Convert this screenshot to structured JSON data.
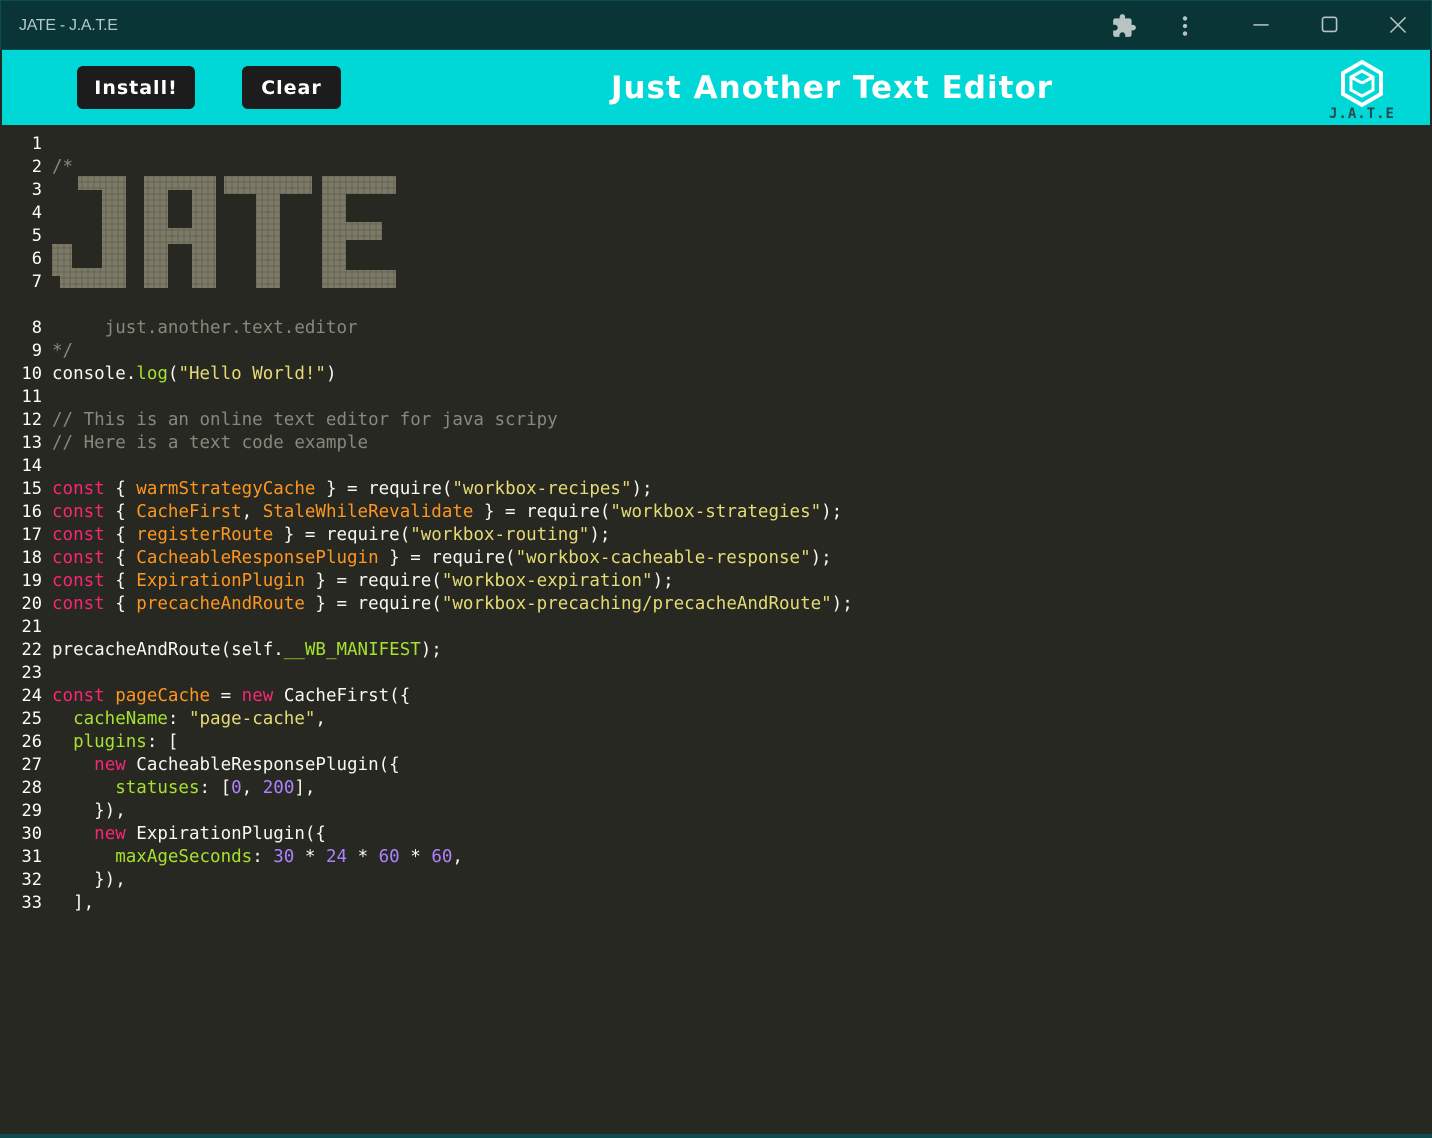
{
  "window": {
    "title": "JATE - J.A.T.E",
    "controls": [
      "extensions-icon",
      "menu-icon",
      "minimize-icon",
      "maximize-icon",
      "close-icon"
    ]
  },
  "header": {
    "install_label": "Install!",
    "clear_label": "Clear",
    "title": "Just Another Text Editor",
    "logo_text": "J.A.T.E",
    "background": "#00d7d7"
  },
  "editor": {
    "theme": "monokai",
    "ascii_banner": "JATE",
    "line_numbers": [
      "1",
      "2",
      "3",
      "4",
      "5",
      "6",
      "7",
      "8",
      "9",
      "10",
      "11",
      "12",
      "13",
      "14",
      "15",
      "16",
      "17",
      "18",
      "19",
      "20",
      "21",
      "22",
      "23",
      "24",
      "25",
      "26",
      "27",
      "28",
      "29",
      "30",
      "31",
      "32",
      "33"
    ],
    "lines": [
      "",
      "/*",
      "",
      "",
      "",
      "",
      "",
      "     just.another.text.editor",
      "*/",
      "console.log(\"Hello World!\")",
      "",
      "// This is an online text editor for java scripy",
      "// Here is a text code example",
      "",
      "const { warmStrategyCache } = require(\"workbox-recipes\");",
      "const { CacheFirst, StaleWhileRevalidate } = require(\"workbox-strategies\");",
      "const { registerRoute } = require(\"workbox-routing\");",
      "const { CacheableResponsePlugin } = require(\"workbox-cacheable-response\");",
      "const { ExpirationPlugin } = require(\"workbox-expiration\");",
      "const { precacheAndRoute } = require(\"workbox-precaching/precacheAndRoute\");",
      "",
      "precacheAndRoute(self.__WB_MANIFEST);",
      "",
      "const pageCache = new CacheFirst({",
      "  cacheName: \"page-cache\",",
      "  plugins: [",
      "    new CacheableResponsePlugin({",
      "      statuses: [0, 200],",
      "    }),",
      "    new ExpirationPlugin({",
      "      maxAgeSeconds: 30 * 24 * 60 * 60,",
      "    }),",
      "  ],"
    ],
    "colors": {
      "keyword": "#f92672",
      "definition": "#fd971f",
      "string": "#e6db74",
      "comment": "#8a887c",
      "property": "#a6e22e",
      "number": "#ae81ff"
    }
  }
}
